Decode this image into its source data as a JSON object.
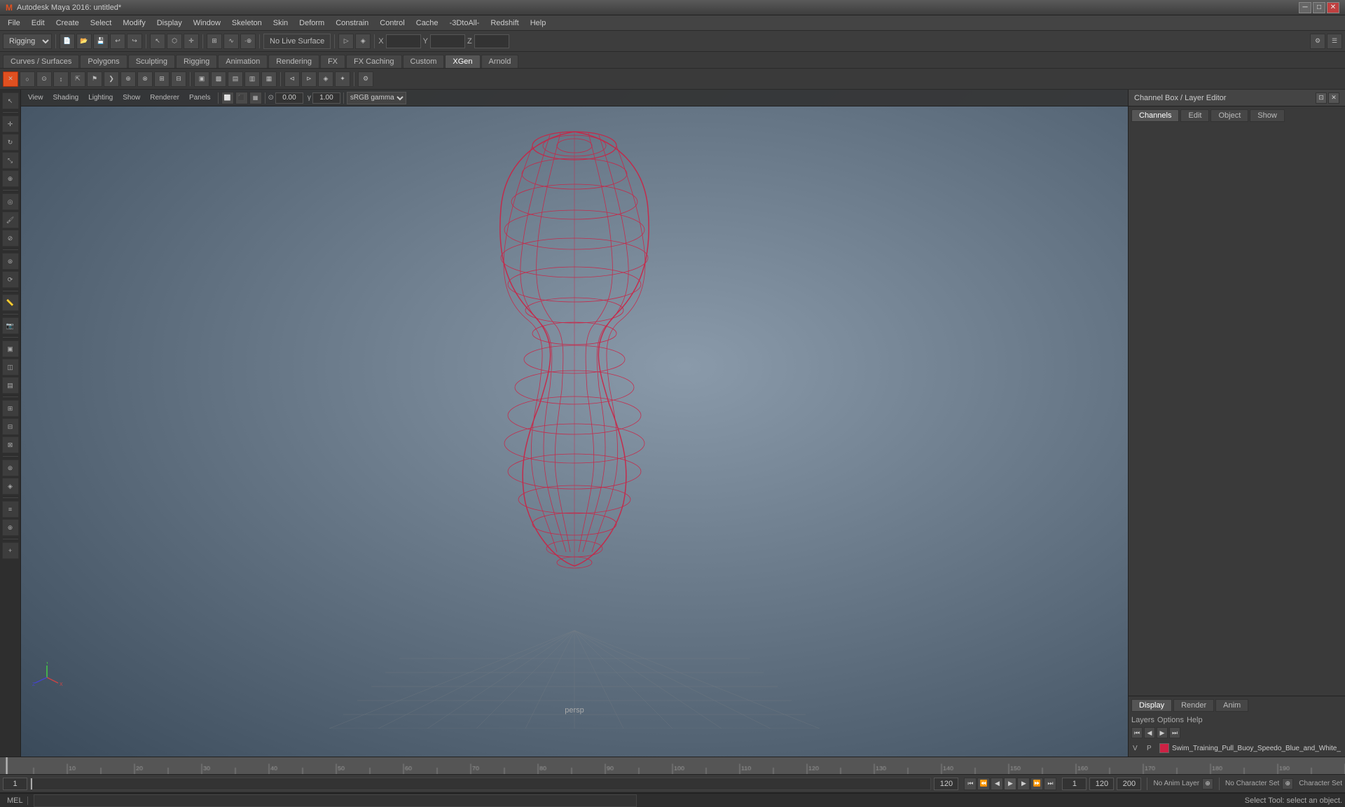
{
  "titlebar": {
    "title": "Autodesk Maya 2016: untitled*",
    "minimize": "─",
    "maximize": "□",
    "close": "✕"
  },
  "menubar": {
    "items": [
      "File",
      "Edit",
      "Create",
      "Select",
      "Modify",
      "Display",
      "Window",
      "Skeleton",
      "Skin",
      "Deform",
      "Constrain",
      "Control",
      "Cache",
      "-3DtoAll-",
      "Redshift",
      "Help"
    ]
  },
  "main_toolbar": {
    "mode_dropdown": "Rigging",
    "no_live_surface": "No Live Surface",
    "x_label": "X",
    "y_label": "Y",
    "z_label": "Z",
    "x_val": "",
    "y_val": "",
    "z_val": ""
  },
  "tabs1": {
    "items": [
      "Curves / Surfaces",
      "Polygons",
      "Sculpting",
      "Rigging",
      "Animation",
      "Rendering",
      "FX",
      "FX Caching",
      "Custom",
      "XGen",
      "Arnold"
    ],
    "active": "XGen"
  },
  "viewport": {
    "view": "View",
    "shading": "Shading",
    "lighting": "Lighting",
    "show": "Show",
    "renderer": "Renderer",
    "panels": "Panels",
    "exposure_val": "0.00",
    "gamma_val": "1.00",
    "color_space": "sRGB gamma",
    "persp_label": "persp"
  },
  "right_panel": {
    "title": "Channel Box / Layer Editor",
    "tabs": [
      "Channels",
      "Edit",
      "Object",
      "Show"
    ],
    "active_tab": "Channels",
    "display_tabs": [
      "Display",
      "Render",
      "Anim"
    ],
    "active_display_tab": "Display",
    "layers_tabs": [
      "Layers",
      "Options",
      "Help"
    ],
    "layer_row": {
      "v": "V",
      "p": "P",
      "name": "Swim_Training_Pull_Buoy_Speedo_Blue_and_White_mb_s"
    }
  },
  "timeline": {
    "start": "1",
    "end": "120",
    "current_frame": "1",
    "range_start": "1",
    "range_end": "120",
    "range_end2": "200"
  },
  "playback": {
    "btn_start": "⏮",
    "btn_prev_key": "◀◀",
    "btn_prev": "◀",
    "btn_play": "▶",
    "btn_next": "▶",
    "btn_next_key": "▶▶",
    "btn_end": "⏭",
    "anim_layer": "No Anim Layer",
    "character_set": "No Character Set",
    "char_set_label": "Character Set"
  },
  "statusbar": {
    "mel_label": "MEL",
    "mel_placeholder": "",
    "status_text": "Select Tool: select an object."
  },
  "colors": {
    "accent_red": "#cc2244",
    "bg_dark": "#2e2e2e",
    "bg_mid": "#3a3a3a",
    "bg_light": "#4a4a4a",
    "text_normal": "#cccccc",
    "text_dim": "#888888"
  }
}
